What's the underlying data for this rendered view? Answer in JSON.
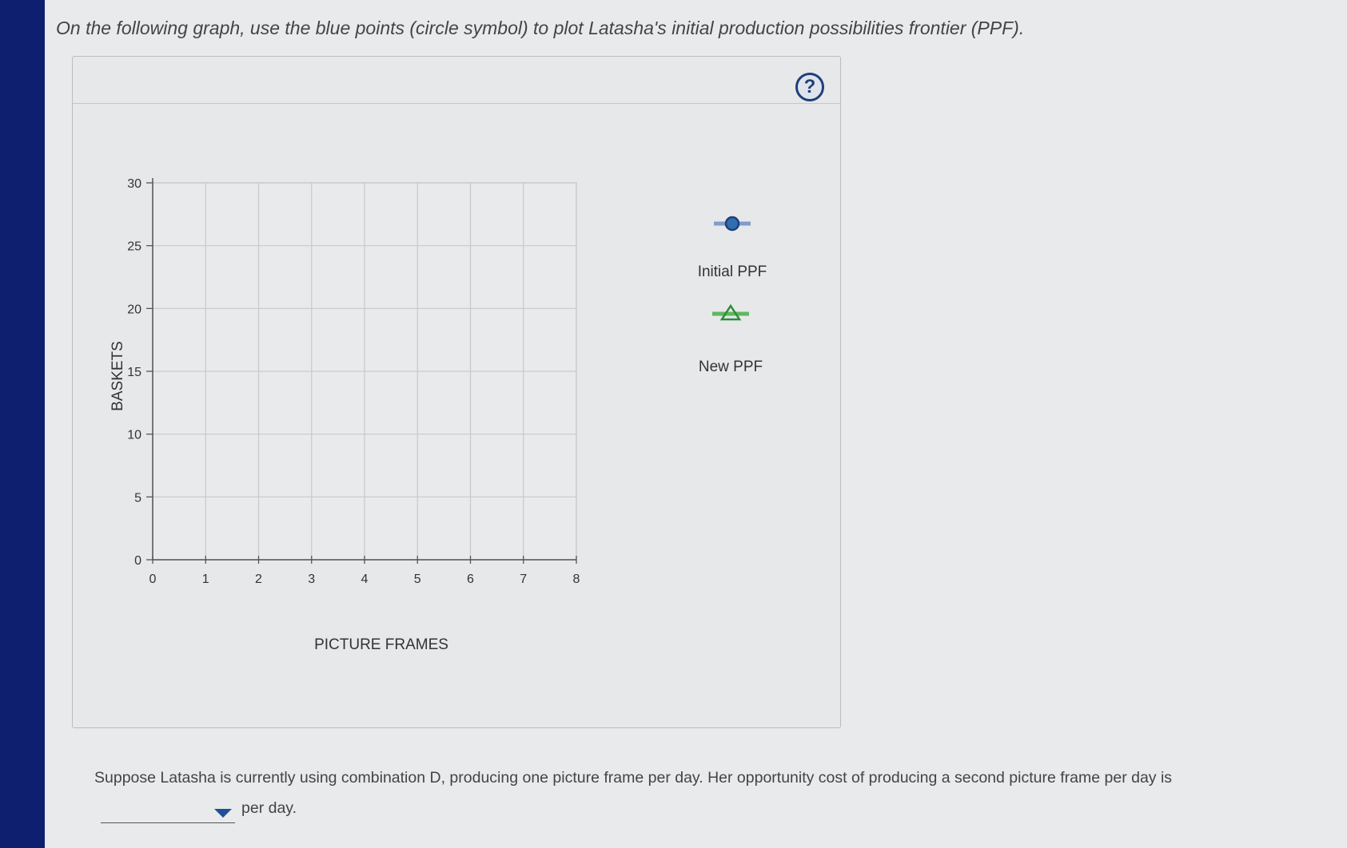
{
  "prompt": "On the following graph, use the blue points (circle symbol) to plot Latasha's initial production possibilities frontier (PPF).",
  "help_button": {
    "label": "?"
  },
  "legend": [
    {
      "label": "Initial PPF",
      "symbol": "circle",
      "color": "#2f6fb0",
      "line_color": "#7f9ccc"
    },
    {
      "label": "New PPF",
      "symbol": "triangle",
      "color": "#2e8b3a",
      "line_color": "#5eb85e"
    }
  ],
  "chart_data": {
    "type": "scatter",
    "xlabel": "PICTURE FRAMES",
    "ylabel": "BASKETS",
    "xlim": [
      0,
      8
    ],
    "ylim": [
      0,
      30
    ],
    "x_ticks": [
      "0",
      "1",
      "2",
      "3",
      "4",
      "5",
      "6",
      "7",
      "8"
    ],
    "y_ticks": [
      "0",
      "5",
      "10",
      "15",
      "20",
      "25",
      "30"
    ],
    "grid": true,
    "series": []
  },
  "question": {
    "before": "Suppose Latasha is currently using combination D, producing one picture frame per day. Her opportunity cost of producing a second picture frame per day is",
    "selected_value": "",
    "after": "per day."
  }
}
